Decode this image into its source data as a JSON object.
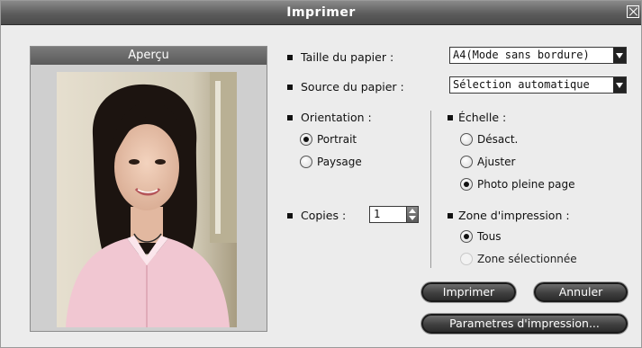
{
  "window": {
    "title": "Imprimer"
  },
  "preview": {
    "header": "Aperçu"
  },
  "paper_size": {
    "label": "Taille du papier :",
    "value": "A4(Mode sans bordure)"
  },
  "paper_source": {
    "label": "Source du papier :",
    "value": "Sélection automatique"
  },
  "orientation": {
    "label": "Orientation :",
    "options": [
      "Portrait",
      "Paysage"
    ],
    "selected": "Portrait"
  },
  "scale": {
    "label": "Échelle :",
    "options": [
      "Désact.",
      "Ajuster",
      "Photo pleine page"
    ],
    "selected": "Photo pleine page"
  },
  "copies": {
    "label": "Copies :",
    "value": "1"
  },
  "print_zone": {
    "label": "Zone d'impression :",
    "options": [
      "Tous",
      "Zone sélectionnée"
    ],
    "selected": "Tous"
  },
  "buttons": {
    "print": "Imprimer",
    "cancel": "Annuler",
    "print_settings": "Parametres d'impression..."
  }
}
